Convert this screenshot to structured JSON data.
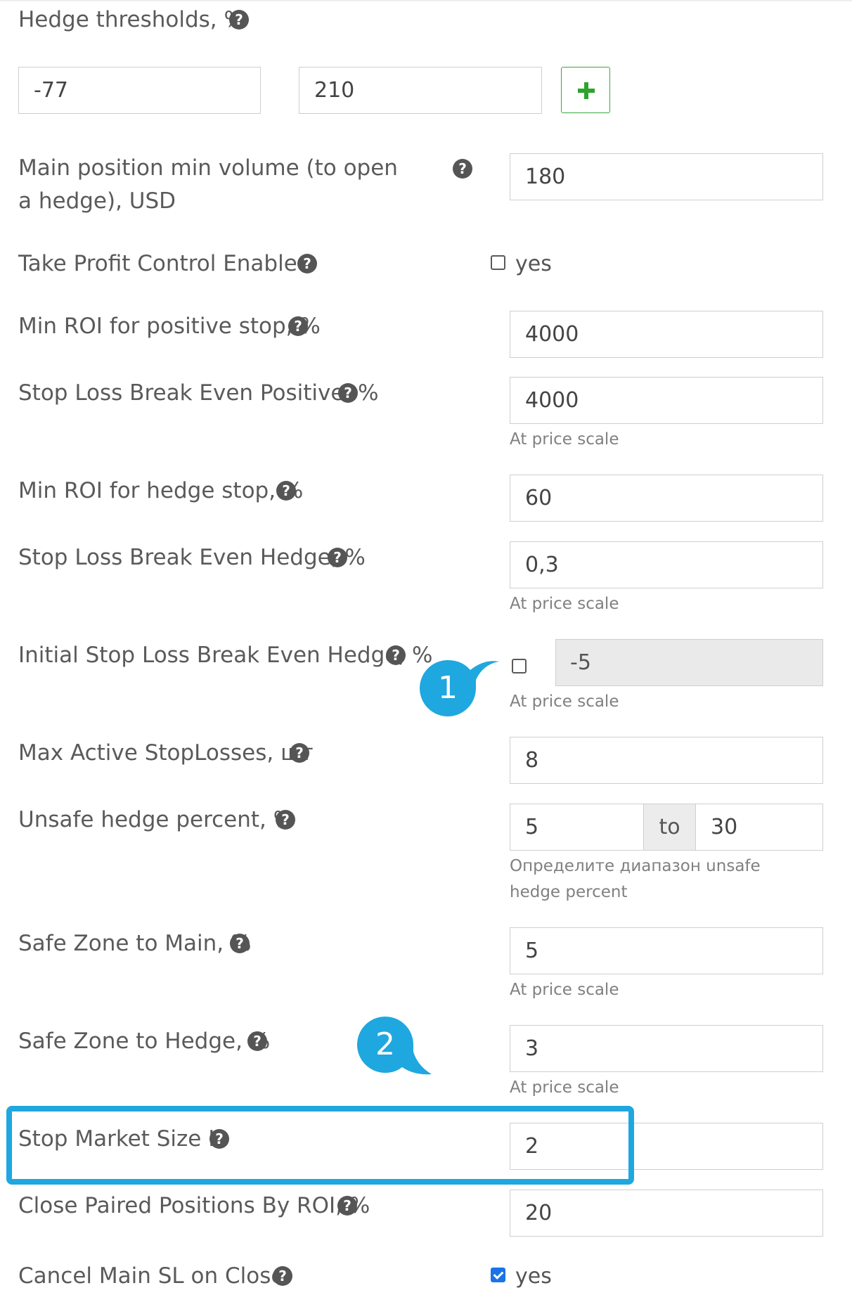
{
  "hedge_thresholds": {
    "label": "Hedge thresholds, %",
    "values": [
      "-77",
      "210"
    ]
  },
  "main_min_volume": {
    "label": "Main position min volume (to open a hedge), USD",
    "value": "180"
  },
  "take_profit_control": {
    "label": "Take Profit Control Enabled",
    "checkbox_label": "yes",
    "checked": false
  },
  "min_roi_positive": {
    "label": "Min ROI for positive stop, %",
    "value": "4000"
  },
  "sl_be_positive": {
    "label": "Stop Loss Break Even Positive, %",
    "value": "4000",
    "hint": "At price scale"
  },
  "min_roi_hedge": {
    "label": "Min ROI for hedge stop, %",
    "value": "60"
  },
  "sl_be_hedge": {
    "label": "Stop Loss Break Even Hedge, %",
    "value": "0,3",
    "hint": "At price scale"
  },
  "initial_sl_be_hedge": {
    "label": "Initial Stop Loss Break Even Hedge, %",
    "checked": false,
    "value": "-5",
    "hint": "At price scale"
  },
  "max_active_stoplosses": {
    "label": "Max Active StopLosses, шт",
    "value": "8"
  },
  "unsafe_hedge_percent": {
    "label": "Unsafe hedge percent, %",
    "from": "5",
    "to_label": "to",
    "to": "30",
    "hint": "Определите диапазон unsafe hedge percent"
  },
  "safe_zone_main": {
    "label": "Safe Zone to Main, %",
    "value": "5",
    "hint": "At price scale"
  },
  "safe_zone_hedge": {
    "label": "Safe Zone to Hedge, %",
    "value": "3",
    "hint": "At price scale"
  },
  "stop_market_size": {
    "label": "Stop Market Size K",
    "value": "2"
  },
  "close_paired": {
    "label": "Close Paired Positions By ROI, %",
    "value": "20"
  },
  "cancel_main_sl": {
    "label": "Cancel Main SL on Close",
    "checkbox_label": "yes",
    "checked": true
  },
  "help_glyph": "?",
  "callouts": [
    {
      "number": "1",
      "color": "#1fa7e0"
    },
    {
      "number": "2",
      "color": "#1fa7e0"
    }
  ],
  "icons": {
    "help": "question-circle-icon",
    "add": "plus-icon"
  },
  "colors": {
    "accent": "#1fa7e0",
    "add_button": "#2ea32e",
    "checkbox_checked": "#1a73e8"
  }
}
